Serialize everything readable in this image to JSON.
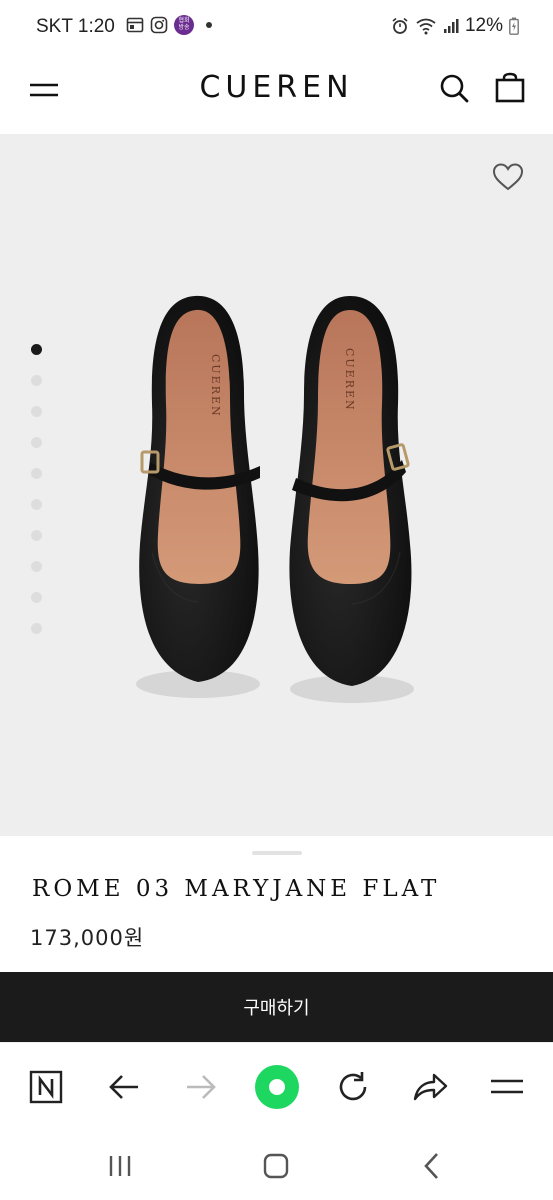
{
  "status_bar": {
    "carrier_time": "SKT 1:20",
    "battery": "12%",
    "app_badge": "협회 방송"
  },
  "header": {
    "logo": "CUEREN"
  },
  "product": {
    "name": "ROME 03 MARYJANE FLAT",
    "price": "173,000원",
    "image_count": 10,
    "active_image_index": 0,
    "insole_brand": "CUEREN"
  },
  "buy_button": {
    "label": "구매하기"
  },
  "browser_toolbar": {
    "items": [
      "n-logo-icon",
      "back-arrow-icon",
      "forward-arrow-icon",
      "green-home-icon",
      "reload-icon",
      "share-icon",
      "menu-icon"
    ]
  },
  "system_nav": {
    "items": [
      "recent-apps-icon",
      "home-icon",
      "back-icon"
    ]
  },
  "colors": {
    "accent_green": "#1ed760",
    "buy_button_bg": "#1b1b1b",
    "hero_bg": "#eeeeee"
  }
}
